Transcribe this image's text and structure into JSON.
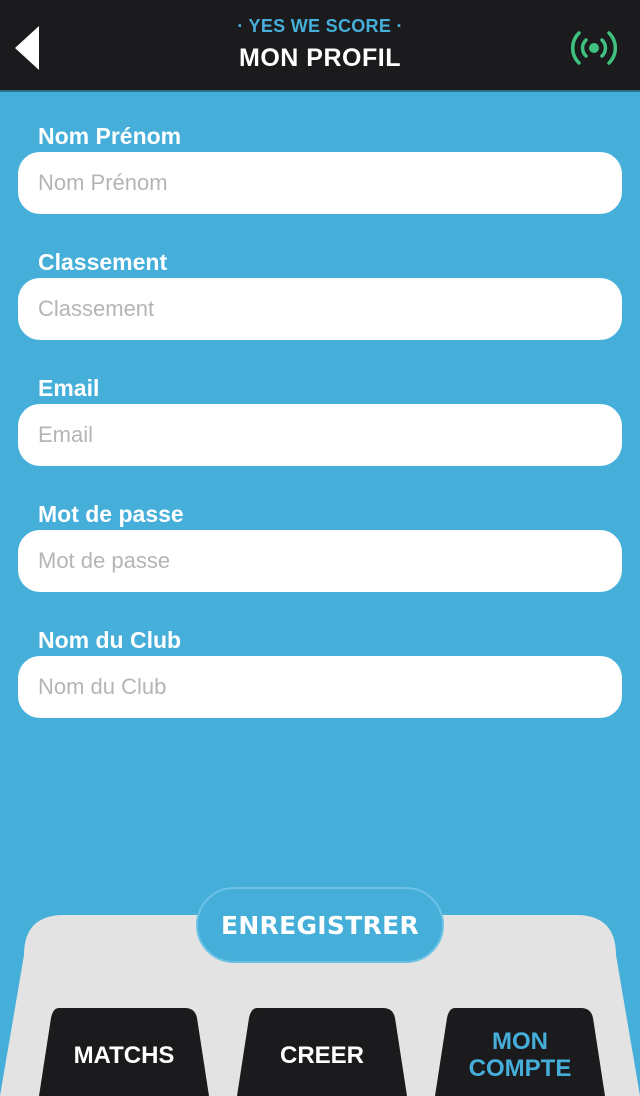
{
  "header": {
    "subtitle": "· YES WE SCORE ·",
    "title": "MON PROFIL",
    "back_icon": "back-arrow-icon",
    "signal_icon": "broadcast-signal-icon",
    "signal_color": "#3FC17F"
  },
  "form": {
    "name": {
      "label": "Nom Prénom",
      "placeholder": "Nom Prénom",
      "value": ""
    },
    "ranking": {
      "label": "Classement",
      "placeholder": "Classement",
      "value": ""
    },
    "email": {
      "label": "Email",
      "placeholder": "Email",
      "value": ""
    },
    "password": {
      "label": "Mot de passe",
      "placeholder": "Mot de passe",
      "value": ""
    },
    "club": {
      "label": "Nom du Club",
      "placeholder": "Nom du Club",
      "value": ""
    }
  },
  "actions": {
    "save_label": "ENREGISTRER"
  },
  "tabs": {
    "matchs": {
      "label": "MATCHS"
    },
    "creer": {
      "label": "CREER"
    },
    "compte": {
      "label_line1": "MON",
      "label_line2": "COMPTE",
      "active": true
    }
  },
  "colors": {
    "background": "#45AFDA",
    "header": "#1B1A1C",
    "panel": "#E3E3E3",
    "tab": "#1B1A1C",
    "active_tab_text": "#45AFDA"
  }
}
